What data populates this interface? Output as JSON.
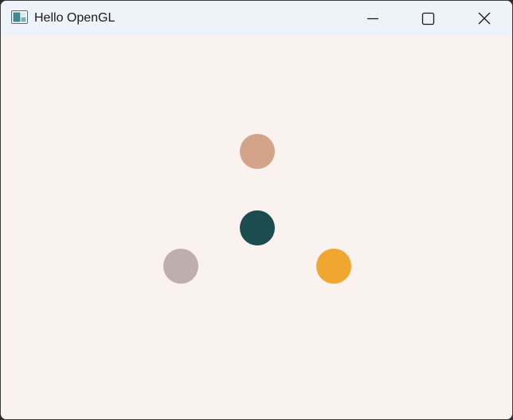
{
  "window": {
    "title": "Hello OpenGL",
    "app_icon": "opengl-app-icon",
    "controls": {
      "minimize_icon": "minimize-icon",
      "maximize_icon": "maximize-icon",
      "close_icon": "close-icon"
    }
  },
  "canvas": {
    "background": "#faf2ee",
    "points": [
      {
        "name": "top",
        "color": "#d4a48a"
      },
      {
        "name": "center",
        "color": "#1b4c4f"
      },
      {
        "name": "left",
        "color": "#bfaeae"
      },
      {
        "name": "right",
        "color": "#f0a62f"
      }
    ]
  }
}
